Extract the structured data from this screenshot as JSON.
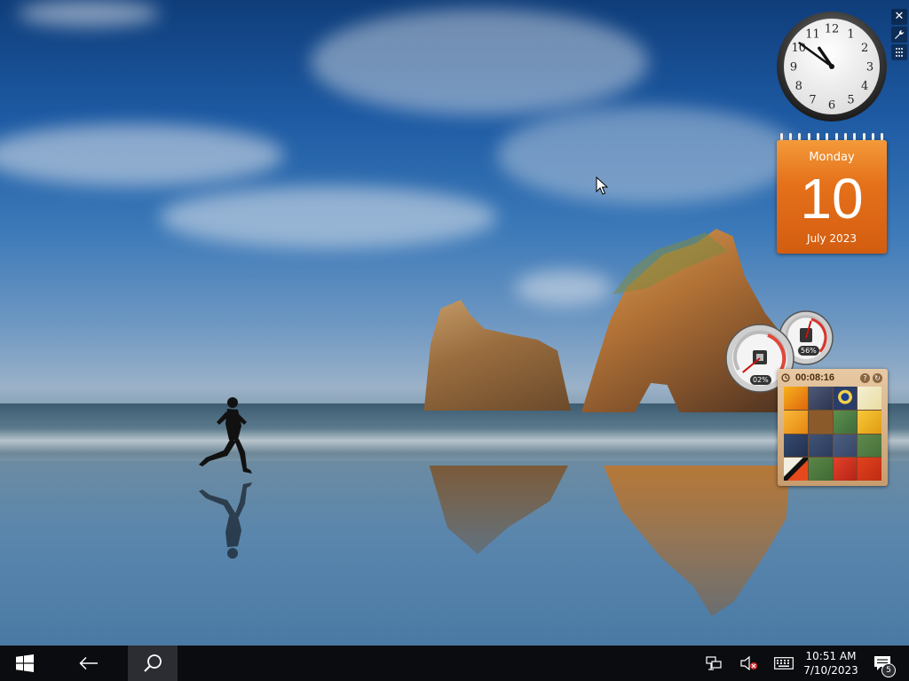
{
  "clock": {
    "numerals": [
      "12",
      "1",
      "2",
      "3",
      "4",
      "5",
      "6",
      "7",
      "8",
      "9",
      "10",
      "11"
    ],
    "hour": 10,
    "minute": 51
  },
  "calendar": {
    "weekday": "Monday",
    "day": "10",
    "month_year": "July 2023",
    "accent_color": "#e5701a"
  },
  "meters": {
    "cpu_percent_label": "02%",
    "cpu_percent": 2,
    "memory_percent_label": "56%",
    "memory_percent": 56
  },
  "puzzle": {
    "elapsed": "00:08:16",
    "help_icon": "?",
    "shuffle_icon": "↻"
  },
  "gadget_tools": {
    "close_icon": "✕",
    "options_icon": "wrench-icon",
    "drag_icon": "grip-icon"
  },
  "taskbar": {
    "time": "10:51 AM",
    "date": "7/10/2023",
    "notification_count": "5"
  }
}
